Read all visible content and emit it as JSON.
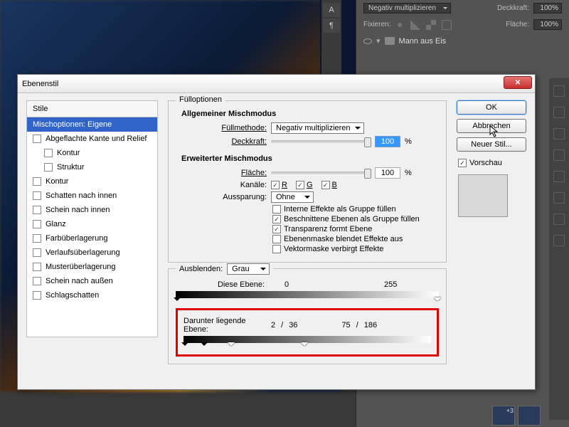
{
  "right_panel": {
    "blend_mode": "Negativ multiplizieren",
    "opacity_label": "Deckkraft:",
    "opacity_value": "100%",
    "lock_label": "Fixieren:",
    "fill_label": "Fläche:",
    "fill_value": "100%",
    "layer_name": "Mann aus Eis"
  },
  "left_tabs": {
    "a": "A",
    "p": "¶"
  },
  "dialog": {
    "title": "Ebenenstil",
    "styles_header": "Stile",
    "styles": [
      {
        "label": "Mischoptionen: Eigene",
        "selected": true,
        "checkbox": false
      },
      {
        "label": "Abgeflachte Kante und Relief",
        "checkbox": true
      },
      {
        "label": "Kontur",
        "checkbox": true,
        "indent": true
      },
      {
        "label": "Struktur",
        "checkbox": true,
        "indent": true
      },
      {
        "label": "Kontur",
        "checkbox": true
      },
      {
        "label": "Schatten nach innen",
        "checkbox": true
      },
      {
        "label": "Schein nach innen",
        "checkbox": true
      },
      {
        "label": "Glanz",
        "checkbox": true
      },
      {
        "label": "Farbüberlagerung",
        "checkbox": true
      },
      {
        "label": "Verlaufsüberlagerung",
        "checkbox": true
      },
      {
        "label": "Musterüberlagerung",
        "checkbox": true
      },
      {
        "label": "Schein nach außen",
        "checkbox": true
      },
      {
        "label": "Schlagschatten",
        "checkbox": true
      }
    ],
    "fill_options": {
      "legend": "Fülloptionen",
      "general_title": "Allgemeiner Mischmodus",
      "blend_mode_label": "Füllmethode:",
      "blend_mode_value": "Negativ multiplizieren",
      "opacity_label": "Deckkraft:",
      "opacity_value": "100",
      "opacity_unit": "%",
      "advanced_title": "Erweiterter Mischmodus",
      "fill_label": "Fläche:",
      "fill_value": "100",
      "fill_unit": "%",
      "channels_label": "Kanäle:",
      "ch_r": "R",
      "ch_g": "G",
      "ch_b": "B",
      "knockout_label": "Aussparung:",
      "knockout_value": "Ohne",
      "cb1": "Interne Effekte als Gruppe füllen",
      "cb2": "Beschnittene Ebenen als Gruppe füllen",
      "cb3": "Transparenz formt Ebene",
      "cb4": "Ebenenmaske blendet Effekte aus",
      "cb5": "Vektormaske verbirgt Effekte"
    },
    "blend_if": {
      "legend": "Ausblenden:",
      "value": "Grau",
      "this_layer_label": "Diese Ebene:",
      "this_low": "0",
      "this_high": "255",
      "under_label": "Darunter liegende Ebene:",
      "under_low1": "2",
      "under_low2": "36",
      "under_high1": "75",
      "under_high2": "186",
      "sep": "/"
    },
    "buttons": {
      "ok": "OK",
      "cancel": "Abbrechen",
      "new_style": "Neuer Stil...",
      "preview": "Vorschau"
    },
    "close_x": "✕"
  },
  "layer_suffix": "+3"
}
